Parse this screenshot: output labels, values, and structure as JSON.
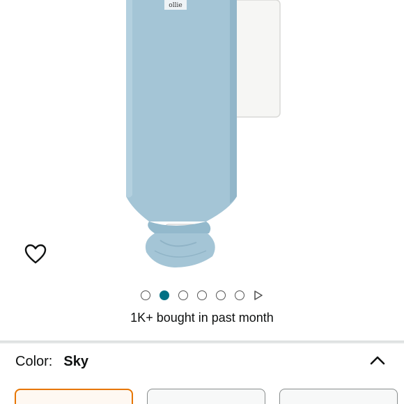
{
  "product": {
    "image_icon": "swaddle-product-image",
    "image_colors": {
      "fabric": "#a4c5d6",
      "fabric_shadow": "#8fb3c6",
      "inner_white": "#f6f6f4"
    }
  },
  "carousel": {
    "dot_count": 6,
    "active_index": 1,
    "play_icon": "play-triangle-icon"
  },
  "social_proof": {
    "bought_text": "1K+ bought in past month"
  },
  "variation": {
    "label": "Color:",
    "selected_value": "Sky",
    "collapse_icon": "chevron-up-icon",
    "swatches": [
      {
        "name": "Sky",
        "selected": true
      },
      {
        "name": "",
        "selected": false
      },
      {
        "name": "",
        "selected": false
      }
    ]
  },
  "colors": {
    "active_dot": "#007185",
    "selected_border": "#e77600"
  }
}
